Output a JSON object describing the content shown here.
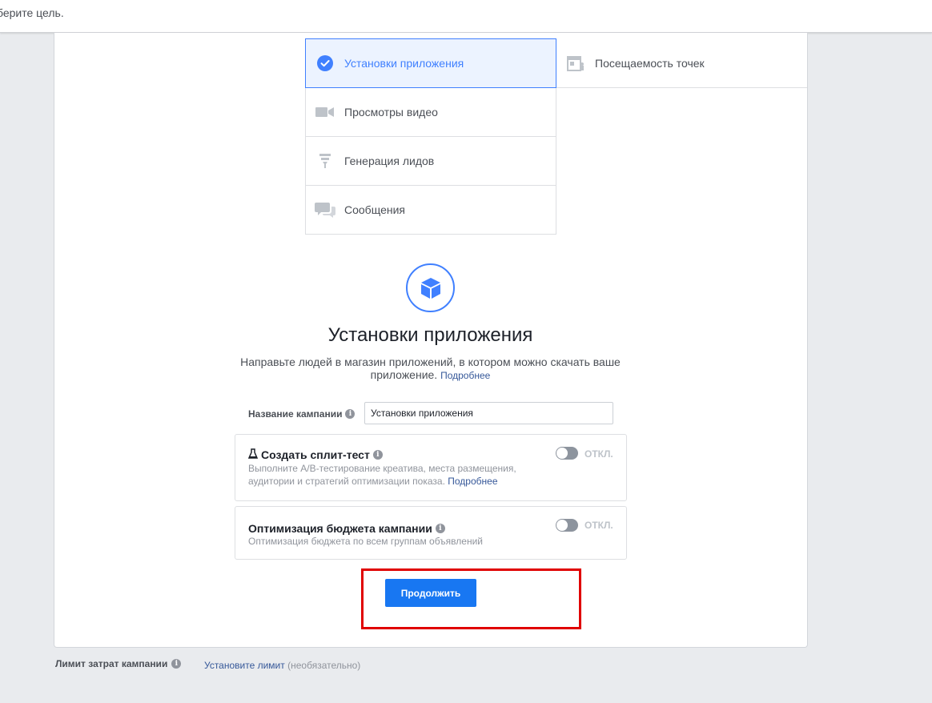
{
  "header": {
    "prompt": "берите цель."
  },
  "objectives": {
    "left": [
      {
        "label": "Установки приложения",
        "icon": "check-circle-icon",
        "selected": true
      },
      {
        "label": "Просмотры видео",
        "icon": "video-camera-icon"
      },
      {
        "label": "Генерация лидов",
        "icon": "funnel-icon"
      },
      {
        "label": "Сообщения",
        "icon": "chat-bubbles-icon"
      }
    ],
    "right": [
      {
        "label": "Посещаемость точек",
        "icon": "store-icon"
      }
    ]
  },
  "selected_objective": {
    "icon": "cube-icon",
    "title": "Установки приложения",
    "description": "Направьте людей в магазин приложений, в котором можно скачать ваше приложение.",
    "learn_more": "Подробнее"
  },
  "campaign_name": {
    "label": "Название кампании",
    "value": "Установки приложения"
  },
  "split_test": {
    "icon": "flask-icon",
    "title": "Создать сплит-тест",
    "description": "Выполните A/B-тестирование креатива, места размещения, аудитории и стратегий оптимизации показа.",
    "learn_more": "Подробнее",
    "toggle_label": "ОТКЛ.",
    "enabled": false
  },
  "budget_optimization": {
    "title": "Оптимизация бюджета кампании",
    "description": "Оптимизация бюджета по всем группам объявлений",
    "toggle_label": "ОТКЛ.",
    "enabled": false
  },
  "continue_button": {
    "label": "Продолжить"
  },
  "spend_limit": {
    "label": "Лимит затрат кампании",
    "link": "Установите лимит",
    "note": "(необязательно)"
  },
  "colors": {
    "accent": "#4080ff",
    "button": "#1877f2",
    "highlight_box": "#e00000",
    "link": "#365899"
  }
}
